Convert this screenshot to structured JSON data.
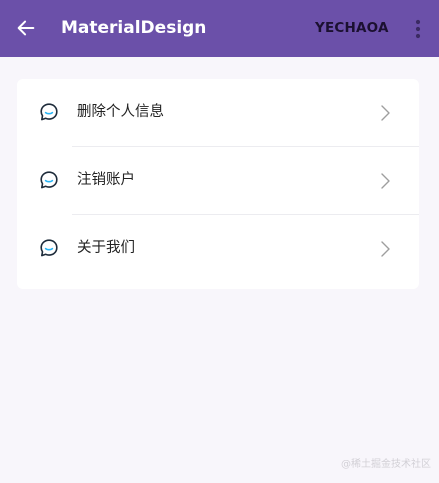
{
  "appbar": {
    "title": "MaterialDesign",
    "action": "YECHAOA",
    "back_icon": "arrow-left-icon",
    "overflow_icon": "more-vert-icon",
    "color": "#6b50a9"
  },
  "list": {
    "items": [
      {
        "label": "删除个人信息",
        "icon": "chat-bubble-icon",
        "trailing_icon": "chevron-right-icon"
      },
      {
        "label": "注销账户",
        "icon": "chat-bubble-icon",
        "trailing_icon": "chevron-right-icon"
      },
      {
        "label": "关于我们",
        "icon": "chat-bubble-icon",
        "trailing_icon": "chevron-right-icon"
      }
    ]
  },
  "watermark": "@稀土掘金技术社区"
}
